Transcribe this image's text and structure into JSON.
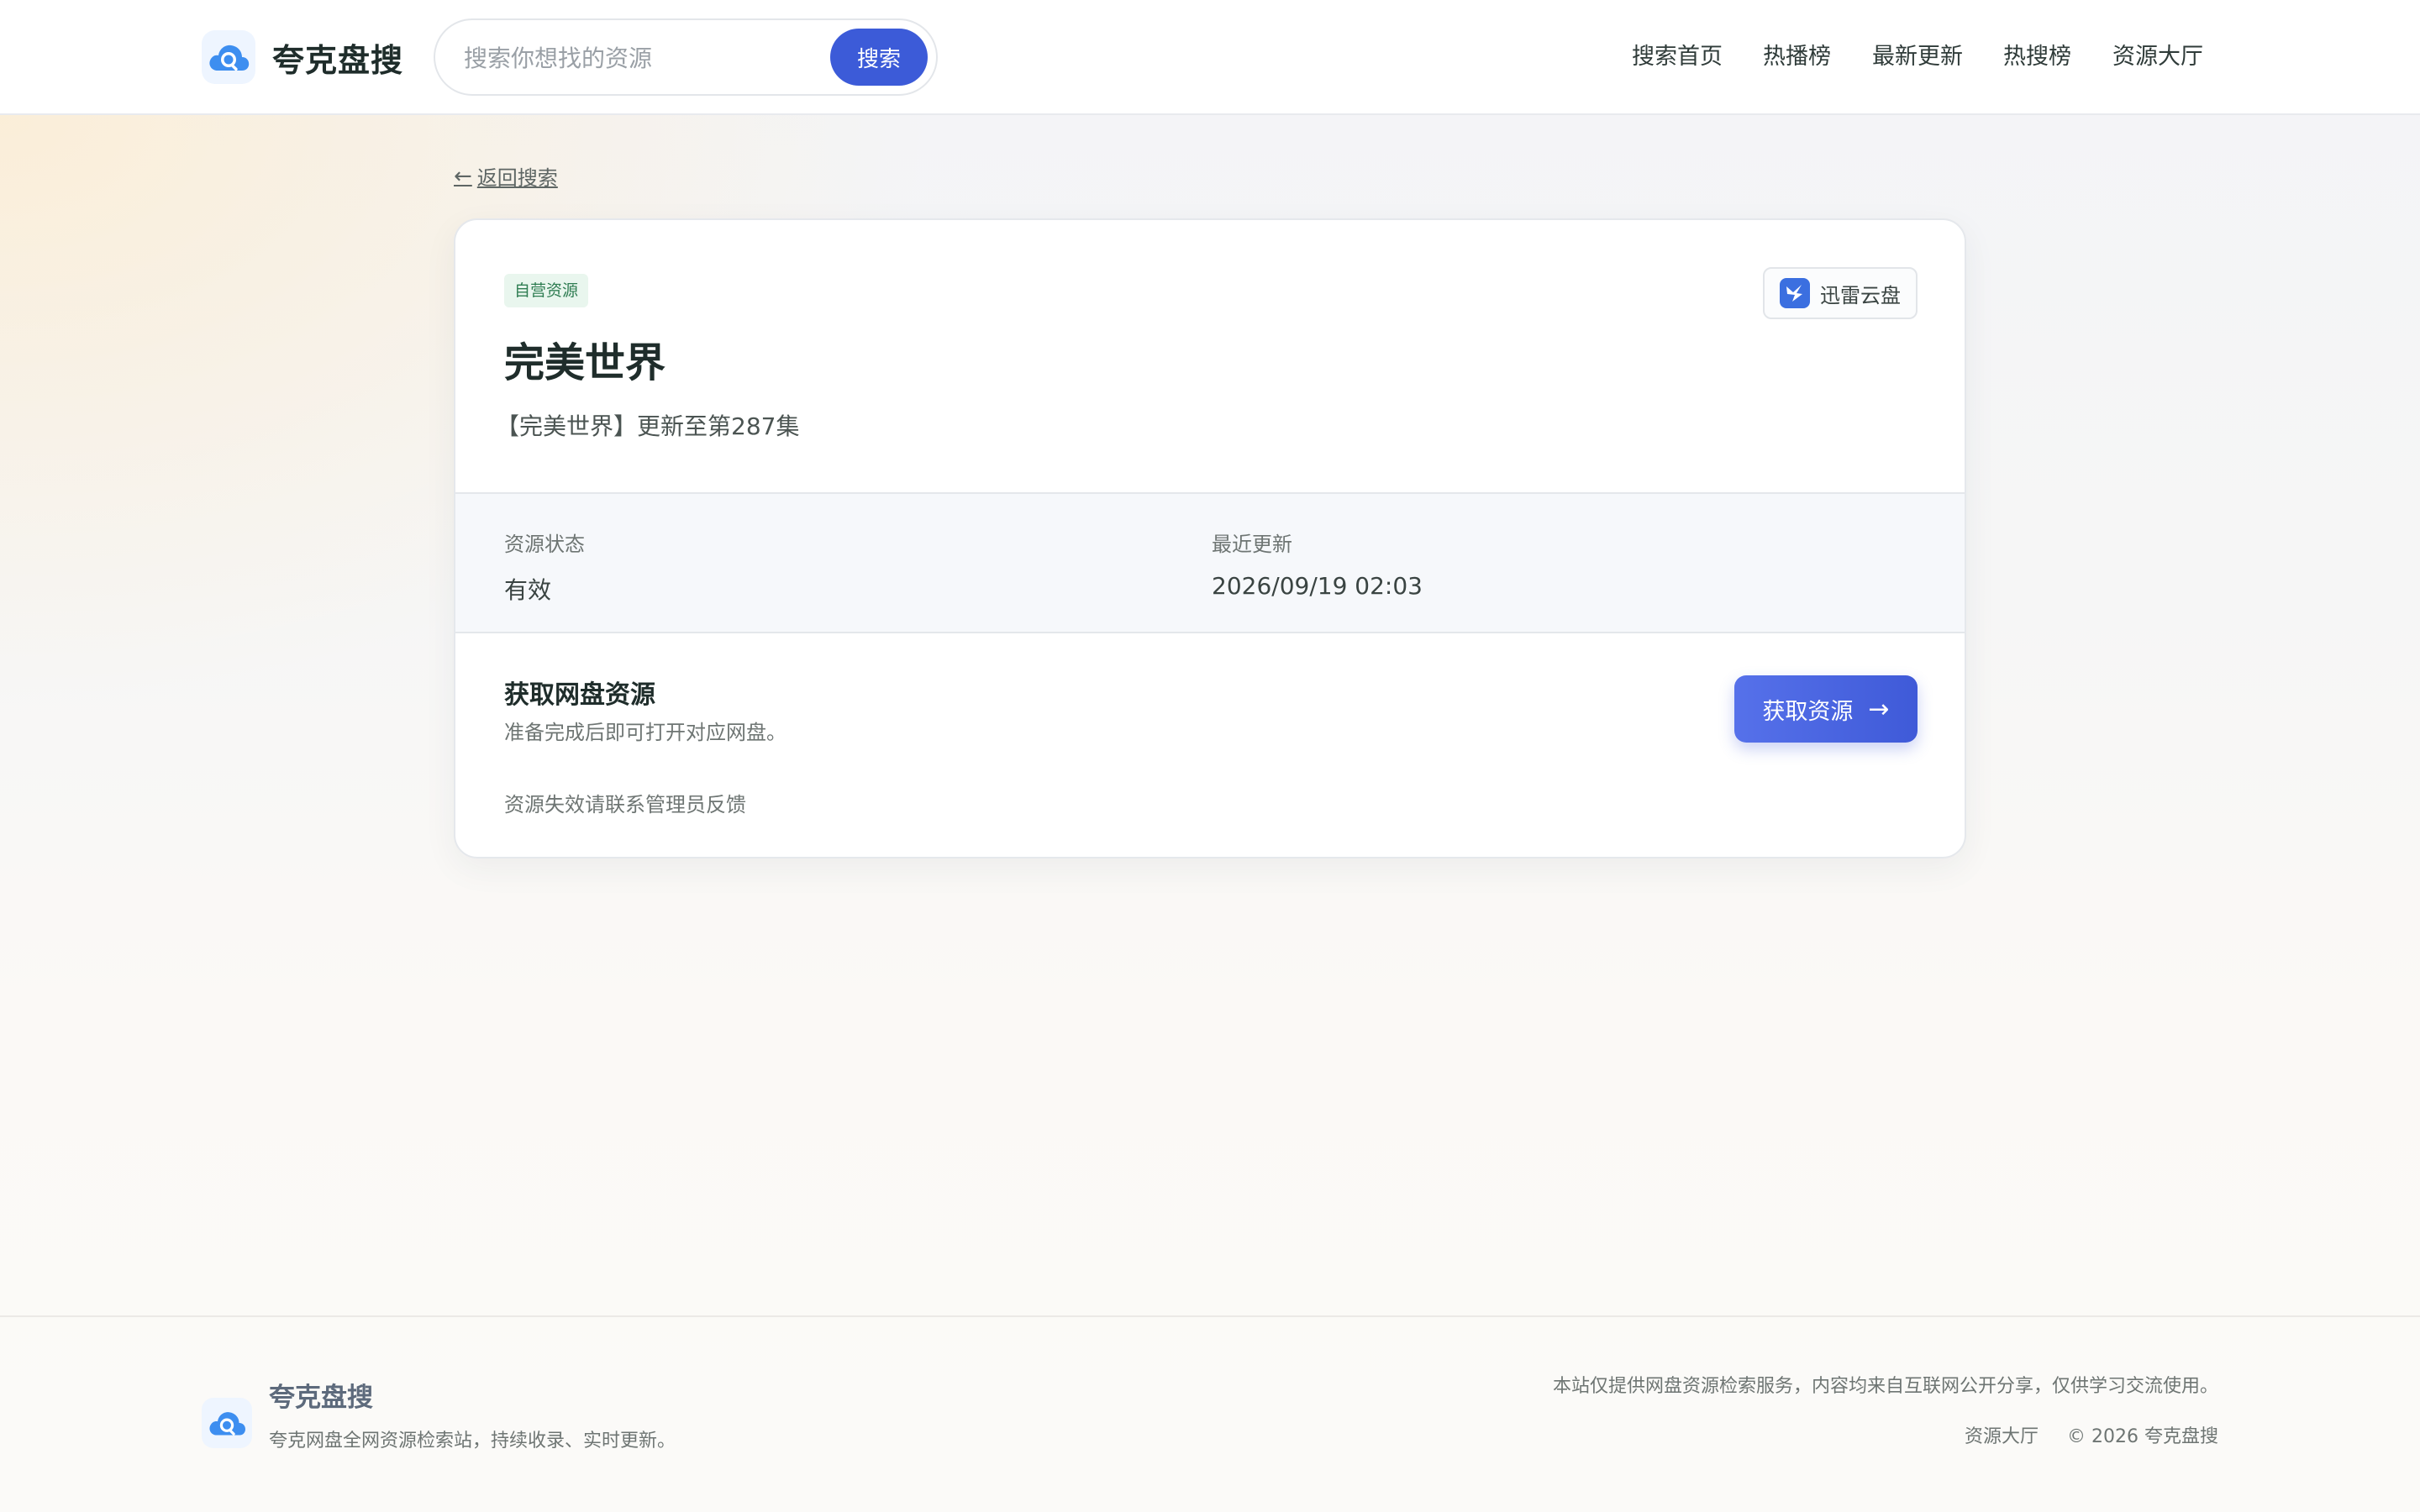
{
  "header": {
    "brand_name": "夸克盘搜",
    "search": {
      "placeholder": "搜索你想找的资源",
      "button_label": "搜索"
    },
    "nav": [
      "搜索首页",
      "热播榜",
      "最新更新",
      "热搜榜",
      "资源大厅"
    ]
  },
  "back_link": "返回搜索",
  "resource": {
    "tag": "自营资源",
    "provider": "迅雷云盘",
    "title": "完美世界",
    "subtitle": "【完美世界】更新至第287集",
    "status_label": "资源状态",
    "status_value": "有效",
    "updated_label": "最近更新",
    "updated_value": "2026/09/19 02:03",
    "get_title": "获取网盘资源",
    "get_desc": "准备完成后即可打开对应网盘。",
    "get_button": "获取资源",
    "report_text": "资源失效请联系管理员反馈"
  },
  "footer": {
    "brand_name": "夸克盘搜",
    "description": "夸克网盘全网资源检索站，持续收录、实时更新。",
    "notice": "本站仅提供网盘资源检索服务，内容均来自互联网公开分享，仅供学习交流使用。",
    "link": "资源大厅",
    "copyright": "© 2026 夸克盘搜"
  },
  "colors": {
    "accent": "#3c5bd8",
    "tag_bg": "#e9f6ee",
    "tag_text": "#2f7d52",
    "provider_icon": "#3b6fe0"
  },
  "icons": {
    "logo": "cloud-search-icon",
    "back": "arrow-left-icon",
    "provider": "thunder-bird-icon",
    "get_button": "arrow-right-icon"
  }
}
